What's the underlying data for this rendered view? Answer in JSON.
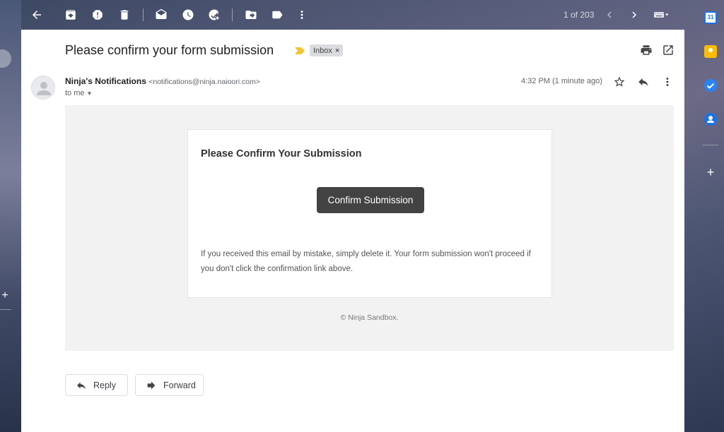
{
  "toolbar": {
    "counter": "1 of 203",
    "icons": [
      "back-arrow-icon",
      "archive-icon",
      "report-spam-icon",
      "delete-icon",
      "mark-unread-icon",
      "snooze-icon",
      "add-to-tasks-icon",
      "move-to-icon",
      "labels-icon",
      "more-vert-icon",
      "newer-chevron-icon",
      "older-chevron-icon",
      "input-tools-icon"
    ]
  },
  "email": {
    "subject": "Please confirm your form submission",
    "label": "Inbox",
    "label_remove": "×",
    "sender_name": "Ninja's Notifications",
    "sender_email": "<notifications@ninja.naioori.com>",
    "recipient": "to me",
    "time": "4:32 PM (1 minute ago)"
  },
  "message": {
    "title": "Please Confirm Your Submission",
    "button": "Confirm Submission",
    "note": "If you received this email by mistake, simply delete it. Your form submission won't proceed if you don't click the confirmation link above.",
    "footer": "© Ninja Sandbox."
  },
  "actions": {
    "reply": "Reply",
    "forward": "Forward"
  },
  "side_panel": {
    "apps": [
      "calendar-icon",
      "keep-icon",
      "tasks-icon",
      "contacts-icon"
    ],
    "add": "+",
    "calendar_day": "31"
  },
  "left_panel": {
    "add": "+"
  },
  "colors": {
    "calendar": "#1a73e8",
    "keep": "#fbbc04",
    "tasks": "#2684fc",
    "contacts": "#1a73e8",
    "button": "#434343",
    "importance": "#f4c430"
  }
}
